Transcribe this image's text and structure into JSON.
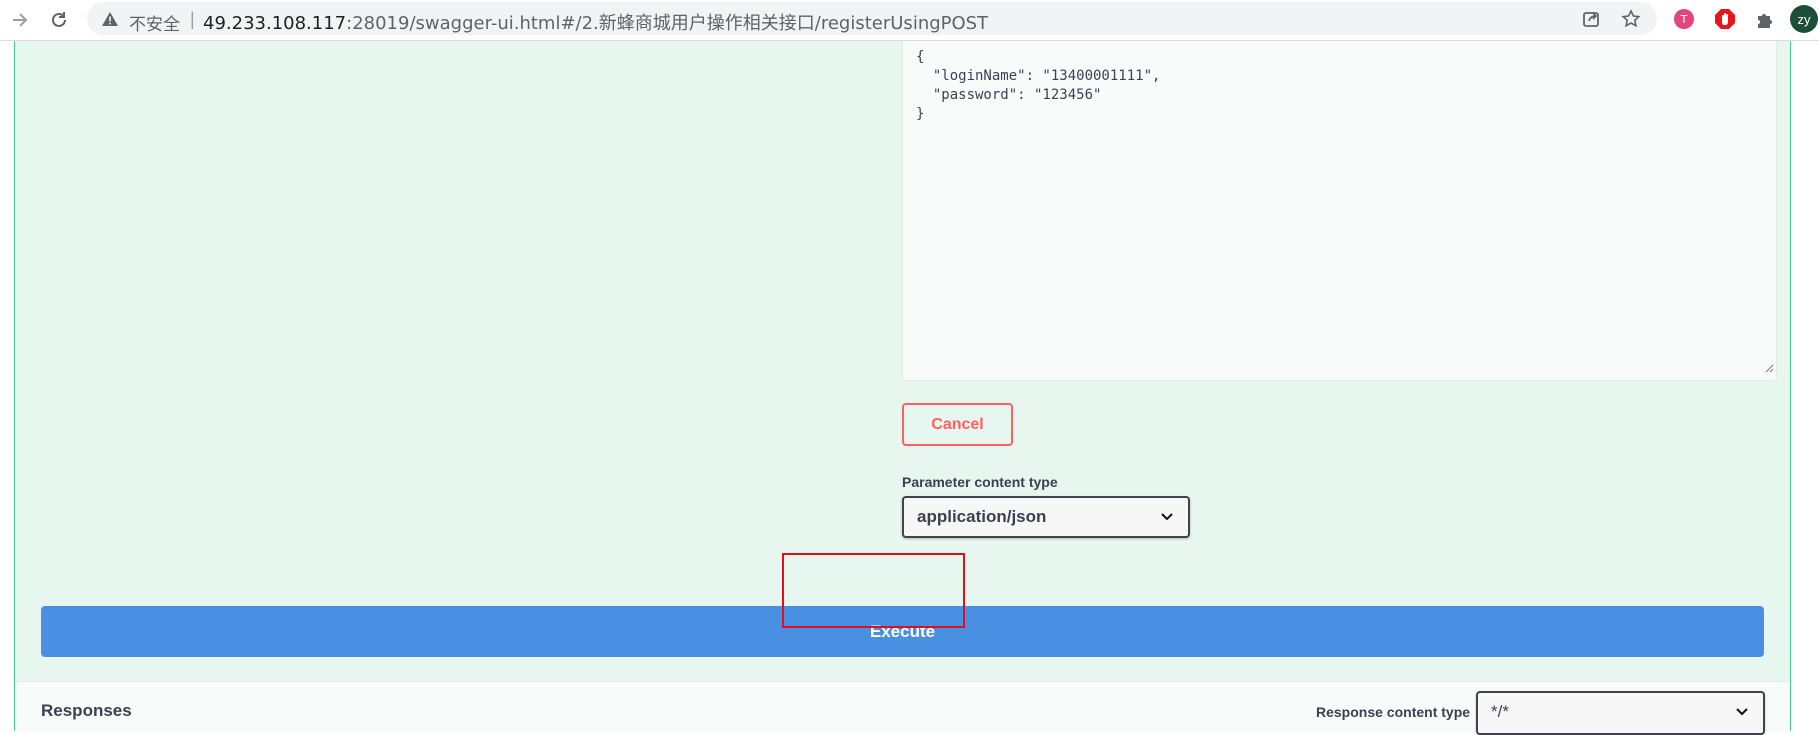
{
  "browser": {
    "security_label": "不安全",
    "separator": "|",
    "url_host": "49.233.108.117",
    "url_rest": ":28019/swagger-ui.html#/2.新蜂商城用户操作相关接口/registerUsingPOST",
    "avatar_text": "zy",
    "icons": [
      "forward-icon",
      "reload-icon",
      "warning-icon",
      "share-icon",
      "star-icon",
      "translate-extension-icon",
      "adblock-extension-icon",
      "puzzle-extension-icon"
    ]
  },
  "request": {
    "body_lines": [
      "{",
      "  \"loginName\": \"13400001111\",",
      "  \"password\": \"123456\"",
      "}"
    ],
    "cancel_label": "Cancel",
    "param_content_type_label": "Parameter content type",
    "param_content_type_value": "application/json",
    "execute_label": "Execute"
  },
  "responses": {
    "title": "Responses",
    "content_type_label": "Response content type",
    "content_type_value": "*/*"
  },
  "colors": {
    "post_green": "#49cc90",
    "panel_bg": "#e8f6f0",
    "execute_blue": "#4990e2",
    "cancel_red": "#ff6060",
    "highlight_red": "#e30e1b"
  }
}
